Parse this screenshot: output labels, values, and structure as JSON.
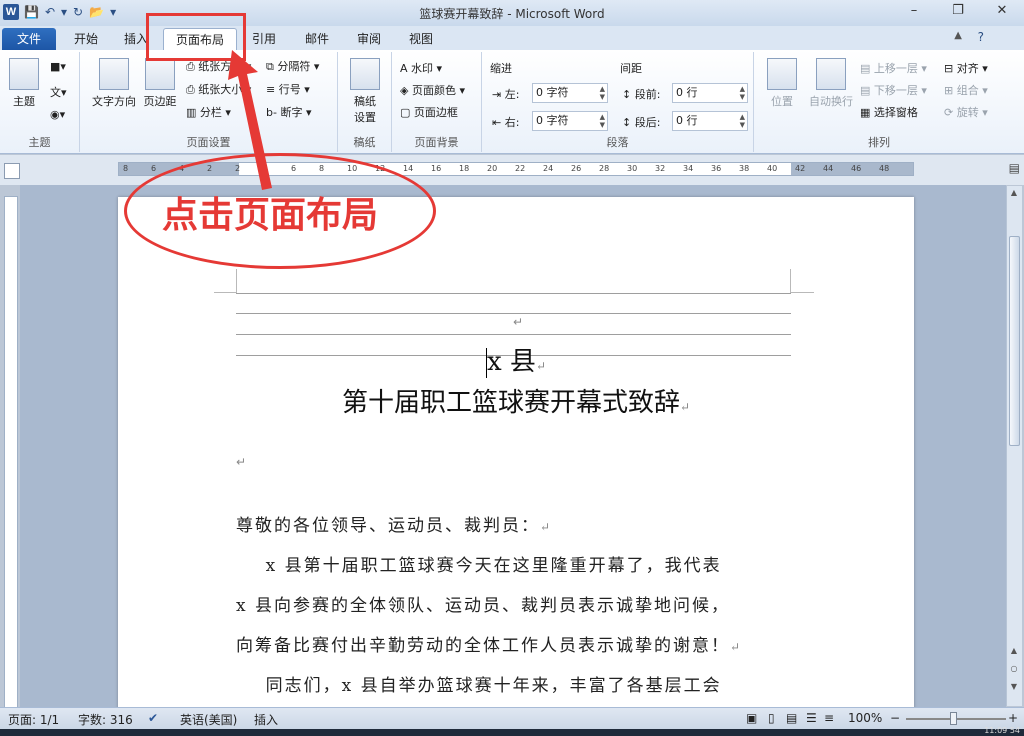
{
  "window": {
    "title": "篮球赛开幕致辞 - Microsoft Word",
    "app_icon_letter": "W",
    "controls": [
      "–",
      "❐",
      "✕"
    ]
  },
  "quick_access": [
    "💾",
    "↶",
    "▾",
    "↻",
    "📂",
    "▾"
  ],
  "tabs": [
    {
      "label": "文件"
    },
    {
      "label": "开始"
    },
    {
      "label": "插入"
    },
    {
      "label": "页面布局"
    },
    {
      "label": "引用"
    },
    {
      "label": "邮件"
    },
    {
      "label": "审阅"
    },
    {
      "label": "视图"
    }
  ],
  "active_tab": "页面布局",
  "ribbon": {
    "themes": {
      "group_label": "主题",
      "button": "主题"
    },
    "page_setup": {
      "group_label": "页面设置",
      "text_direction": "文字方向",
      "margins": "页边距",
      "orientation": "纸张方向",
      "size": "纸张大小",
      "columns": "分栏",
      "breaks": "分隔符",
      "line_numbers": "行号",
      "hyphenation": "断字"
    },
    "draft": {
      "group_label": "稿纸",
      "button1": "稿纸",
      "button2": "设置"
    },
    "page_background": {
      "group_label": "页面背景",
      "watermark": "水印",
      "page_color": "页面颜色",
      "page_borders": "页面边框"
    },
    "paragraph": {
      "group_label": "段落",
      "indent_label": "缩进",
      "spacing_label": "间距",
      "left_label": "左:",
      "right_label": "右:",
      "before_label": "段前:",
      "after_label": "段后:",
      "left_value": "0 字符",
      "right_value": "0 字符",
      "before_value": "0 行",
      "after_value": "0 行"
    },
    "arrange": {
      "group_label": "排列",
      "position": "位置",
      "wrap_text": "自动换行",
      "bring_forward": "上移一层",
      "send_backward": "下移一层",
      "selection_pane": "选择窗格",
      "align": "对齐",
      "group": "组合",
      "rotate": "旋转"
    }
  },
  "ruler_numbers": [
    "8",
    "6",
    "4",
    "2",
    "2",
    "4",
    "6",
    "8",
    "10",
    "12",
    "14",
    "16",
    "18",
    "20",
    "22",
    "24",
    "26",
    "28",
    "30",
    "32",
    "34",
    "36",
    "38",
    "40",
    "42",
    "44",
    "46",
    "48"
  ],
  "callout": {
    "text": "点击页面布局"
  },
  "document": {
    "paragraph_mark": "↵",
    "title_line1": "x 县",
    "title_line2": "第十届职工篮球赛开幕式致辞",
    "salutation": "尊敬的各位领导、运动员、裁判员：",
    "lines": [
      "    x 县第十届职工篮球赛今天在这里隆重开幕了，我代表",
      "x 县向参赛的全体领队、运动员、裁判员表示诚挚地问候，",
      "向筹备比赛付出辛勤劳动的全体工作人员表示诚挚的谢意！",
      "    同志们，x 县自举办篮球赛十年来，丰富了各基层工会"
    ]
  },
  "status_bar": {
    "page": "页面: 1/1",
    "words": "字数: 316",
    "language": "英语(美国)",
    "mode": "插入",
    "zoom": "100%",
    "zoom_minus": "−",
    "zoom_plus": "+"
  },
  "clock": "11:09 54"
}
